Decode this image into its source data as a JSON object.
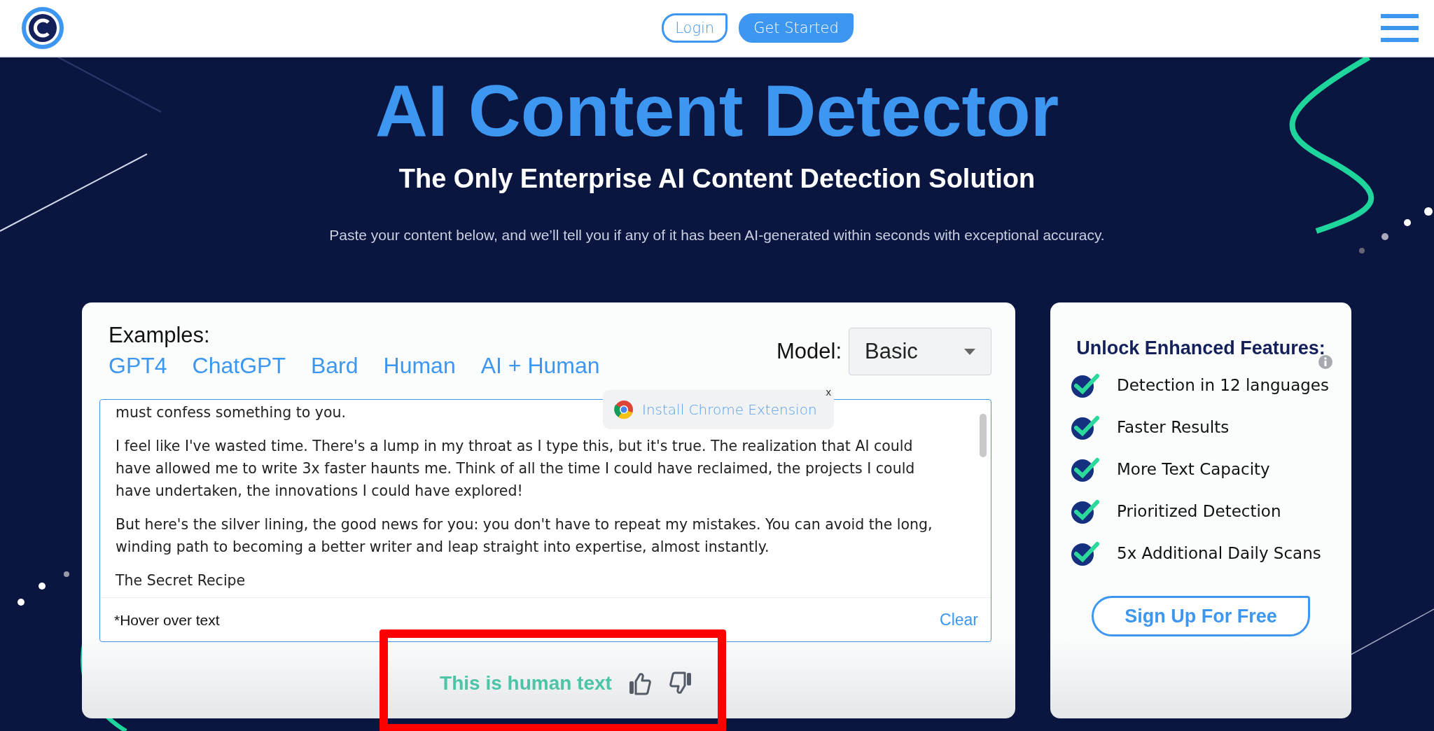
{
  "header": {
    "nav_buttons": [
      {
        "label": "Login",
        "kind": "outline"
      },
      {
        "label": "Get Started",
        "kind": "filled"
      }
    ]
  },
  "hero": {
    "title": "AI Content Detector",
    "subtitle": "The Only Enterprise AI Content Detection Solution",
    "description": "Paste your content below, and we’ll tell you if any of it has been AI-generated within seconds with exceptional accuracy."
  },
  "detector": {
    "examples_label": "Examples:",
    "examples": [
      "GPT4",
      "ChatGPT",
      "Bard",
      "Human",
      "AI + Human"
    ],
    "model_label": "Model:",
    "model": {
      "value": "Basic"
    },
    "text_paragraphs": [
      "must confess something to you.",
      "I feel like I've wasted time. There's a lump in my throat as I type this, but it's true. The realization that AI could have allowed me to write 3x faster haunts me. Think of all the time I could have reclaimed, the projects I could have undertaken, the innovations I could have explored!",
      "But here's the silver lining, the good news for you: you don't have to repeat my mistakes. You can avoid the long, winding path to becoming a better writer and leap straight into expertise, almost instantly.",
      "The Secret Recipe"
    ],
    "extension_prompt": {
      "label": "Install Chrome Extension",
      "close": "x"
    },
    "hint": "*Hover over text",
    "clear": "Clear",
    "result": "This is human text",
    "result_highlighted": true
  },
  "features": {
    "title": "Unlock Enhanced Features:",
    "items": [
      {
        "label": "Detection in 12 languages",
        "info": true
      },
      {
        "label": "Faster Results",
        "info": false
      },
      {
        "label": "More Text Capacity",
        "info": false
      },
      {
        "label": "Prioritized Detection",
        "info": false
      },
      {
        "label": "5x Additional Daily Scans",
        "info": false
      }
    ],
    "signup": "Sign Up For Free"
  }
}
